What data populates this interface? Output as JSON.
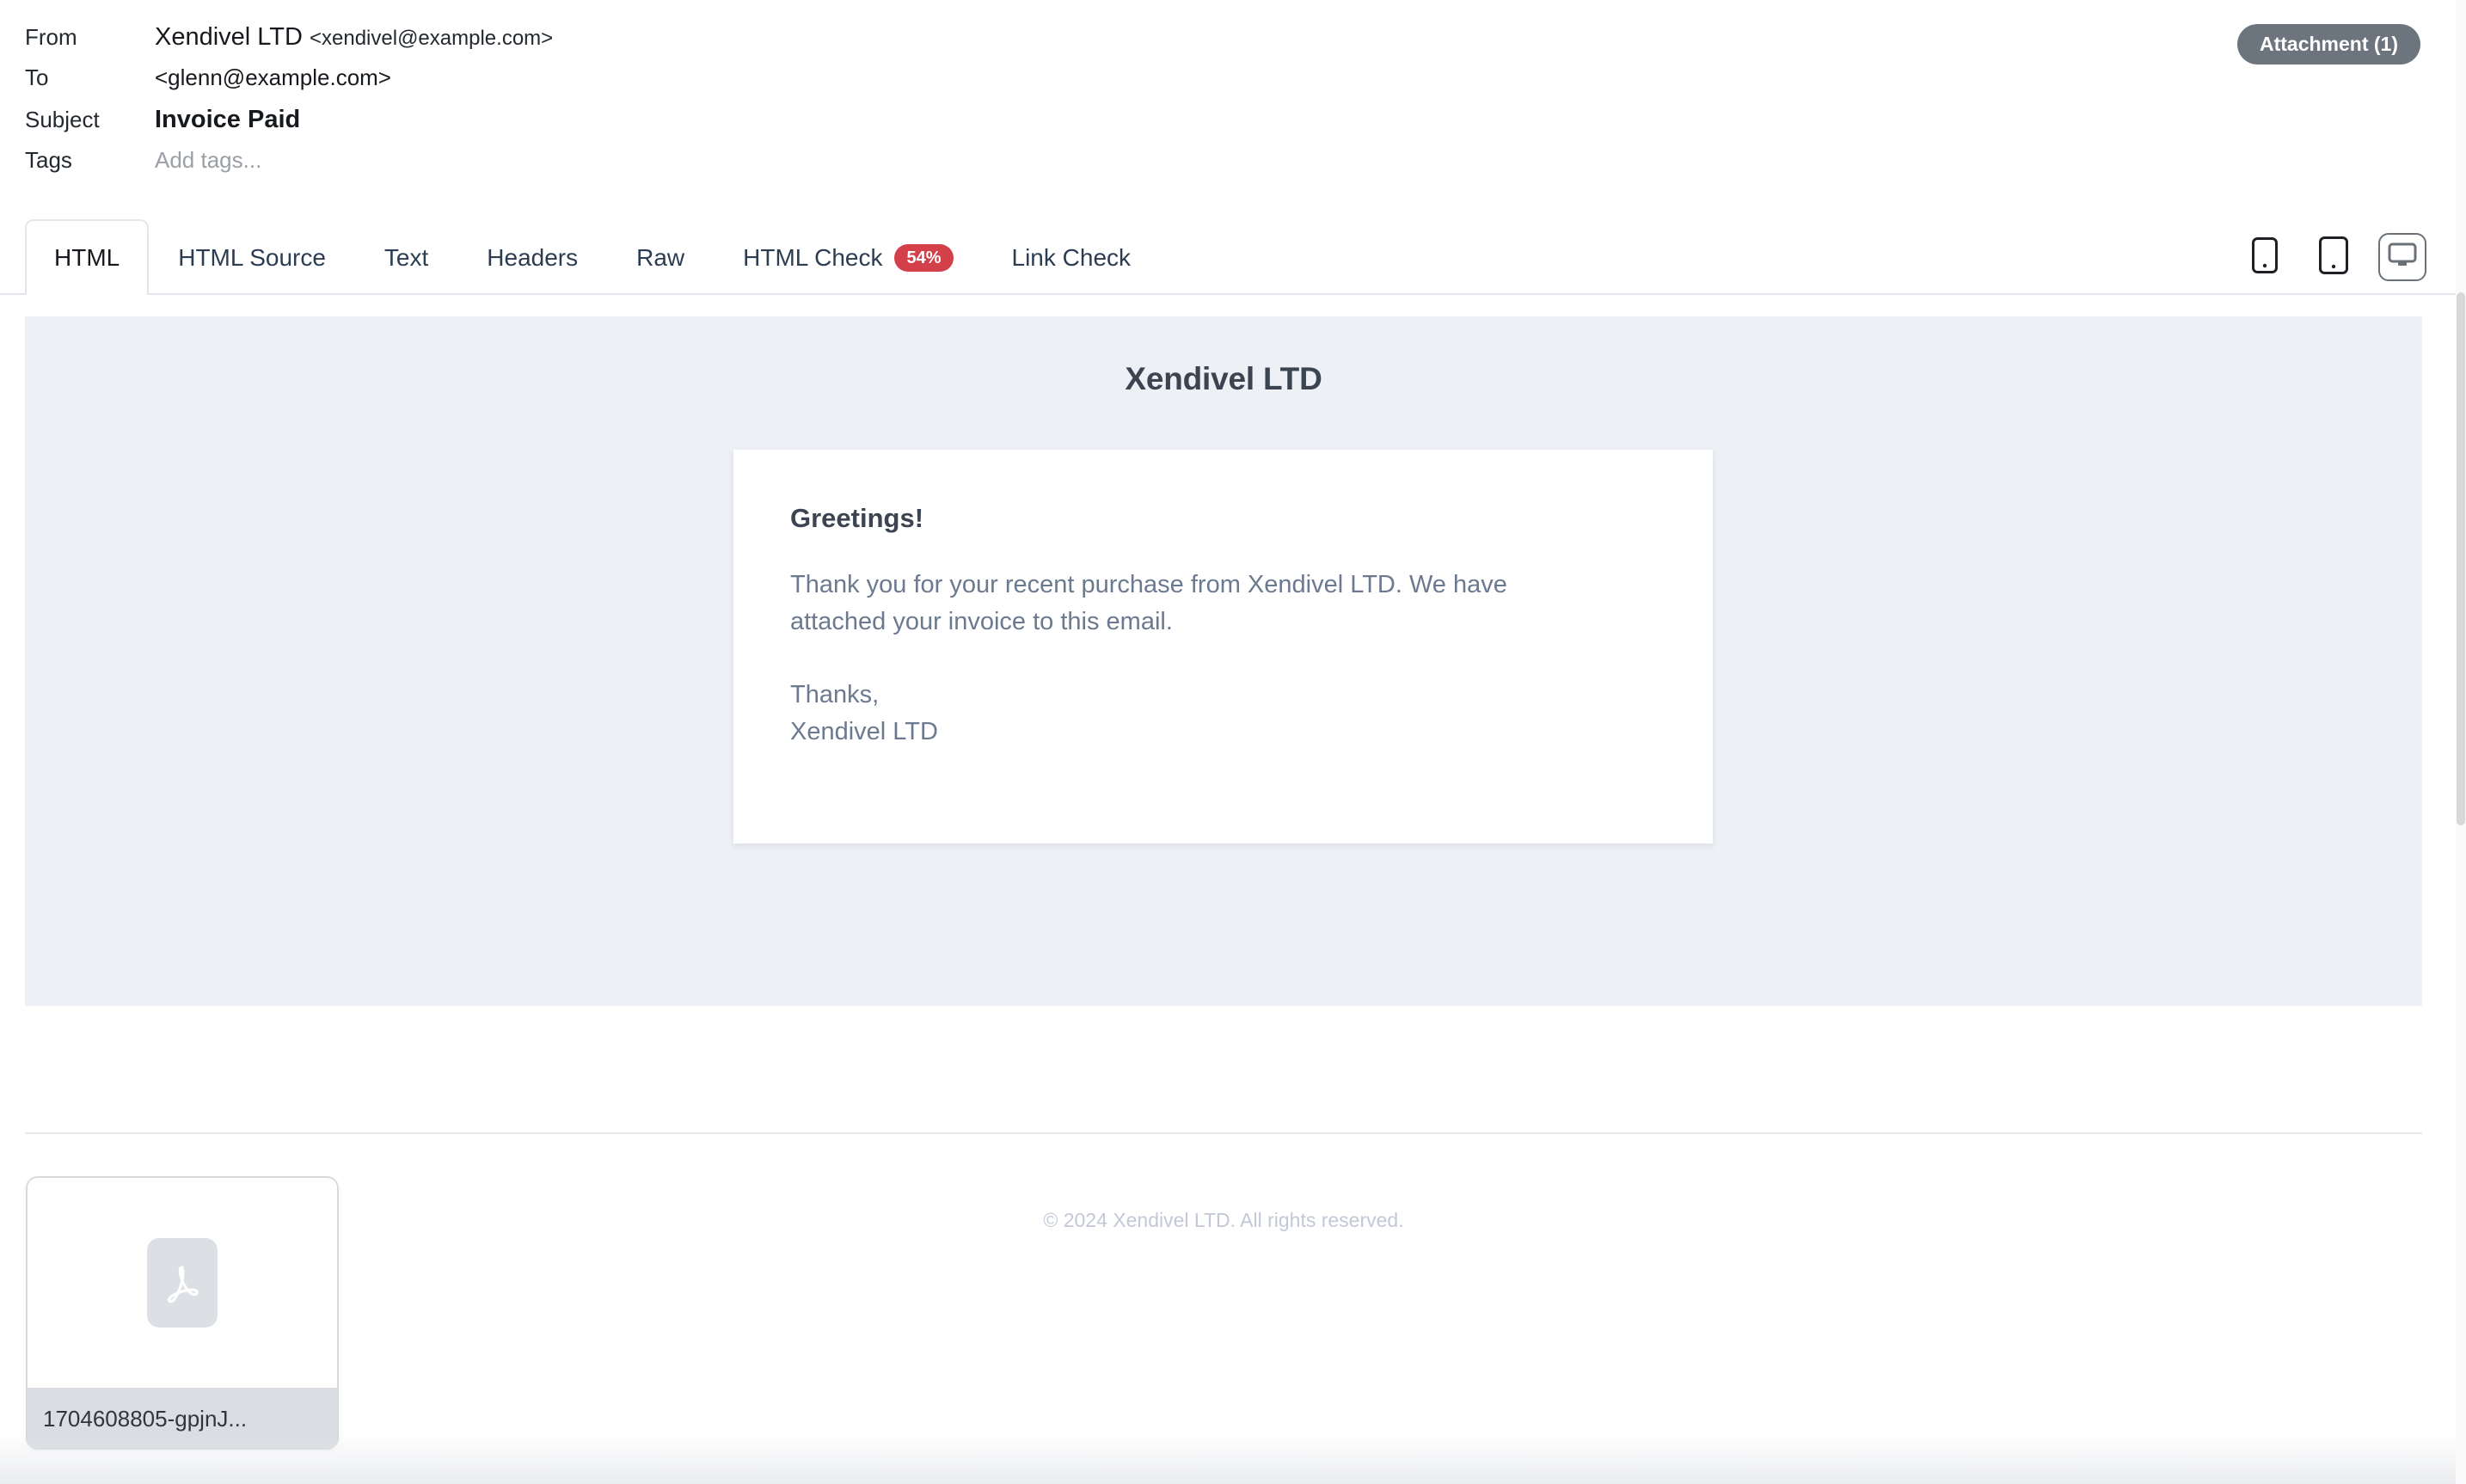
{
  "header": {
    "fields": [
      {
        "label": "From",
        "value": "Xendivel LTD",
        "address": "<xendivel@example.com>"
      },
      {
        "label": "To",
        "value": "",
        "address": "<glenn@example.com>"
      },
      {
        "label": "Subject",
        "value": "Invoice Paid",
        "address": ""
      },
      {
        "label": "Tags",
        "value": "",
        "address": ""
      }
    ],
    "from_label": "From",
    "from_name": "Xendivel LTD",
    "from_address": "<xendivel@example.com>",
    "to_label": "To",
    "to_address": "<glenn@example.com>",
    "subject_label": "Subject",
    "subject_value": "Invoice Paid",
    "tags_label": "Tags",
    "tags_placeholder": "Add tags...",
    "attachment_badge": "Attachment (1)",
    "attachment_badge_color": "#6c757d"
  },
  "tabs": {
    "items": [
      {
        "label": "HTML",
        "active": true,
        "badge": null
      },
      {
        "label": "HTML Source",
        "active": false,
        "badge": null
      },
      {
        "label": "Text",
        "active": false,
        "badge": null
      },
      {
        "label": "Headers",
        "active": false,
        "badge": null
      },
      {
        "label": "Raw",
        "active": false,
        "badge": null
      },
      {
        "label": "HTML Check",
        "active": false,
        "badge": "54%"
      },
      {
        "label": "Link Check",
        "active": false,
        "badge": null
      }
    ],
    "html_label": "HTML",
    "html_source_label": "HTML Source",
    "text_label": "Text",
    "headers_label": "Headers",
    "raw_label": "Raw",
    "html_check_label": "HTML Check",
    "html_check_badge": "54%",
    "html_check_badge_color": "#d4404a",
    "link_check_label": "Link Check"
  },
  "viewport": {
    "mobile_icon": "mobile-icon",
    "tablet_icon": "tablet-icon",
    "desktop_icon": "desktop-icon",
    "active": "desktop"
  },
  "email": {
    "brand_title": "Xendivel LTD",
    "greeting": "Greetings!",
    "paragraph": "Thank you for your recent purchase from Xendivel LTD. We have attached your invoice to this email.",
    "signoff_line1": "Thanks,",
    "signoff_line2": "Xendivel LTD",
    "footer": "© 2024 Xendivel LTD. All rights reserved.",
    "background_color": "#edf0f5",
    "card_background": "#ffffff",
    "heading_color": "#3c4452",
    "body_text_color": "#6b7a90",
    "footer_text_color": "#c3c8d6"
  },
  "attachments": {
    "items": [
      {
        "filename": "1704608805-gpjnJ...",
        "type": "pdf",
        "icon": "pdf-icon"
      }
    ],
    "first_filename": "1704608805-gpjnJ..."
  }
}
